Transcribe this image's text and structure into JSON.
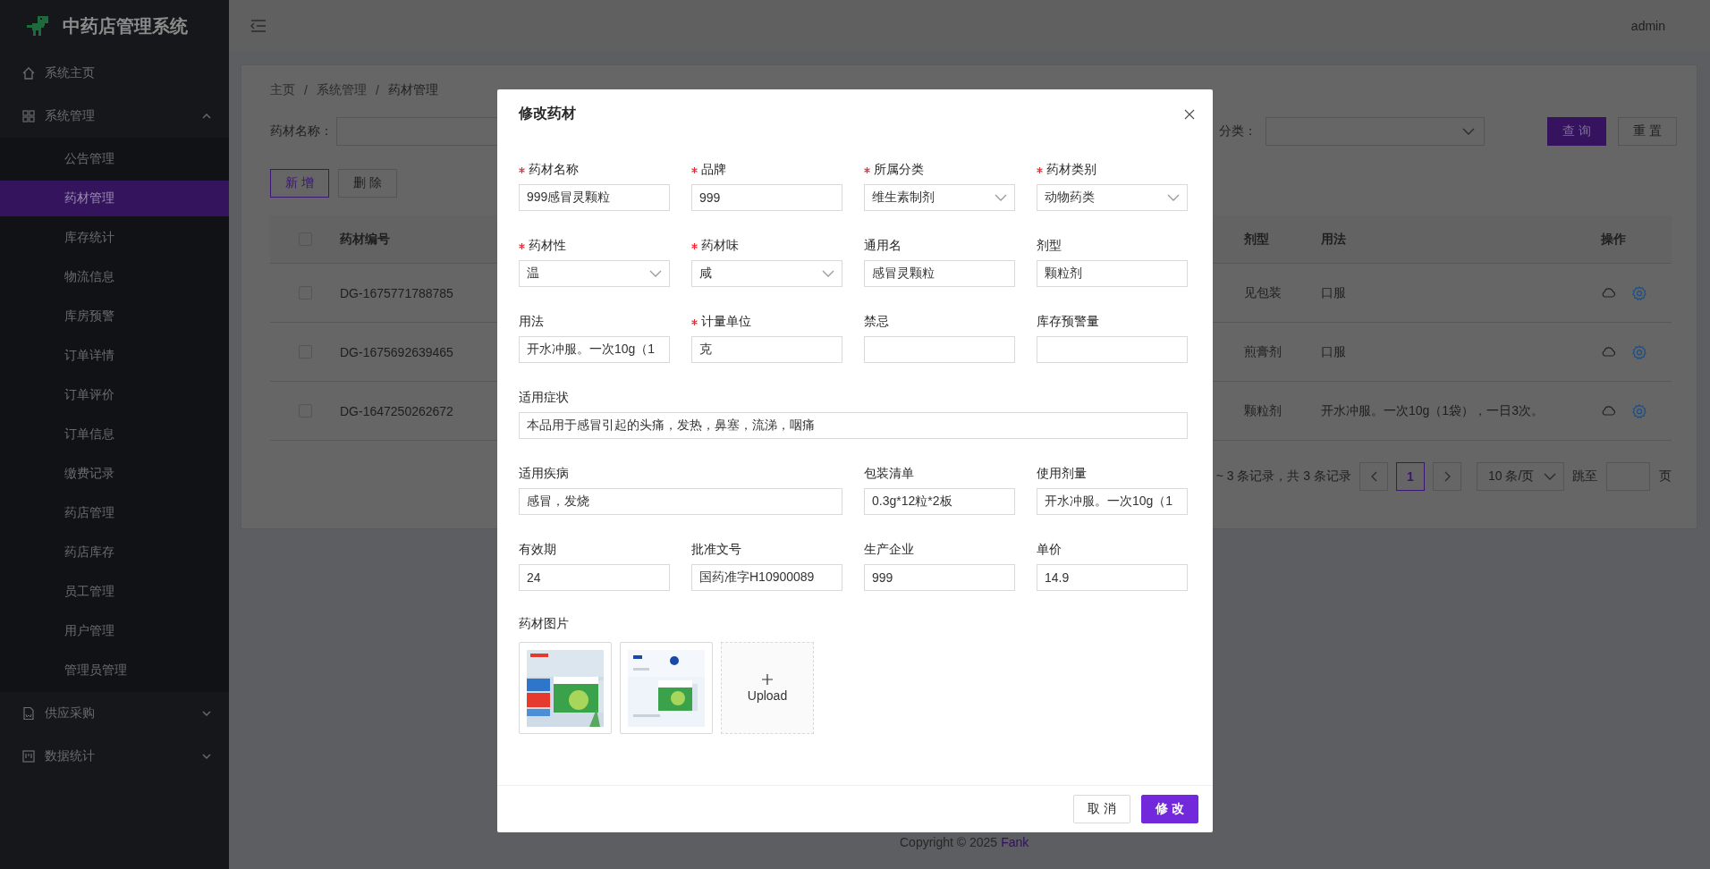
{
  "sidebar": {
    "title": "中药店管理系统",
    "items": [
      {
        "label": "系统主页",
        "selected": false
      },
      {
        "label": "系统管理",
        "selected": false,
        "expanded": true,
        "children": [
          {
            "label": "公告管理",
            "selected": false
          },
          {
            "label": "药材管理",
            "selected": true
          },
          {
            "label": "库存统计",
            "selected": false
          },
          {
            "label": "物流信息",
            "selected": false
          },
          {
            "label": "库房预警",
            "selected": false
          },
          {
            "label": "订单详情",
            "selected": false
          },
          {
            "label": "订单评价",
            "selected": false
          },
          {
            "label": "订单信息",
            "selected": false
          },
          {
            "label": "缴费记录",
            "selected": false
          },
          {
            "label": "药店管理",
            "selected": false
          },
          {
            "label": "药店库存",
            "selected": false
          },
          {
            "label": "员工管理",
            "selected": false
          },
          {
            "label": "用户管理",
            "selected": false
          },
          {
            "label": "管理员管理",
            "selected": false
          }
        ]
      },
      {
        "label": "供应采购",
        "selected": false,
        "expanded": false
      },
      {
        "label": "数据统计",
        "selected": false,
        "expanded": false
      }
    ]
  },
  "header": {
    "user": "admin"
  },
  "breadcrumb": {
    "items": [
      "主页",
      "系统管理",
      "药材管理"
    ],
    "separators": [
      "/",
      "/"
    ]
  },
  "search": {
    "name_label": "药材名称：",
    "category_label": "分类：",
    "buttons": [
      {
        "label": "查 询",
        "kind": "primary"
      },
      {
        "label": "重 置",
        "kind": "default"
      }
    ]
  },
  "actions": [
    {
      "label": "新 增",
      "kind": "outlined"
    },
    {
      "label": "删 除",
      "kind": "default"
    }
  ],
  "table": {
    "all_checked": false,
    "columns": [
      "药材编号",
      "剂型",
      "用法",
      "操作"
    ],
    "rows": [
      {
        "checked": false,
        "code": "DG-1675771788785",
        "form": "见包装",
        "usage": "口服"
      },
      {
        "checked": false,
        "code": "DG-1675692639465",
        "form": "煎膏剂",
        "usage": "口服"
      },
      {
        "checked": false,
        "code": "DG-1647250262672",
        "form": "颗粒剂",
        "usage": "开水冲服。一次10g（1袋），一日3次。"
      }
    ]
  },
  "pagination": {
    "summary": "~ 3 条记录，共 3 条记录",
    "pages": [
      {
        "label": "1",
        "selected": true
      }
    ],
    "page_size": "10 条/页",
    "jump_label": "跳至",
    "page_suffix": "页"
  },
  "footer": {
    "text": "Copyright © 2025",
    "link": "Fank"
  },
  "dialog": {
    "title": "修改药材",
    "fields": [
      {
        "label": "药材名称",
        "required": true,
        "kind": "text",
        "value": "999感冒灵颗粒"
      },
      {
        "label": "品牌",
        "required": true,
        "kind": "text",
        "value": "999"
      },
      {
        "label": "所属分类",
        "required": true,
        "kind": "select",
        "value": "维生素制剂"
      },
      {
        "label": "药材类别",
        "required": true,
        "kind": "select",
        "value": "动物药类"
      },
      {
        "label": "药材性",
        "required": true,
        "kind": "select",
        "value": "温"
      },
      {
        "label": "药材味",
        "required": true,
        "kind": "select",
        "value": "咸"
      },
      {
        "label": "通用名",
        "required": false,
        "kind": "text",
        "value": "感冒灵颗粒"
      },
      {
        "label": "剂型",
        "required": false,
        "kind": "text",
        "value": "颗粒剂"
      },
      {
        "label": "用法",
        "required": false,
        "kind": "text",
        "value": "开水冲服。一次10g（1"
      },
      {
        "label": "计量单位",
        "required": true,
        "kind": "text",
        "value": "克"
      },
      {
        "label": "禁忌",
        "required": false,
        "kind": "text"
      },
      {
        "label": "库存预警量",
        "required": false,
        "kind": "text"
      },
      {
        "label": "适用症状",
        "required": false,
        "kind": "full_text",
        "value": "本品用于感冒引起的头痛，发热，鼻塞，流涕，咽痛"
      },
      {
        "label": "适用疾病",
        "required": false,
        "kind": "half_text",
        "value": "感冒，发烧"
      },
      {
        "label": "包装清单",
        "required": false,
        "kind": "text",
        "value": "0.3g*12粒*2板"
      },
      {
        "label": "使用剂量",
        "required": false,
        "kind": "text",
        "value": "开水冲服。一次10g（1"
      },
      {
        "label": "有效期",
        "required": false,
        "kind": "text",
        "value": "24"
      },
      {
        "label": "批准文号",
        "required": false,
        "kind": "text",
        "value": "国药准字H10900089"
      },
      {
        "label": "生产企业",
        "required": false,
        "kind": "text",
        "value": "999"
      },
      {
        "label": "单价",
        "required": false,
        "kind": "text",
        "value": "14.9"
      }
    ],
    "images_label": "药材图片",
    "upload_label": "Upload",
    "buttons": [
      {
        "label": "取 消",
        "kind": "default"
      },
      {
        "label": "修 改",
        "kind": "primary"
      }
    ]
  }
}
